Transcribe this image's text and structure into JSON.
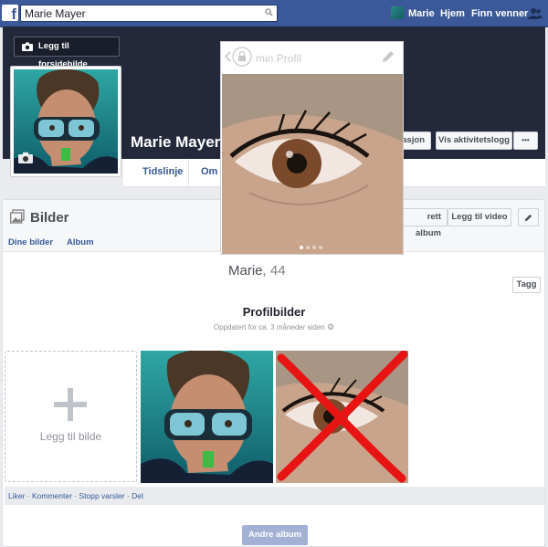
{
  "search": {
    "value": "Marie Mayer"
  },
  "topnav": {
    "user_label": "Marie",
    "home_label": "Hjem",
    "find_friends_label": "Finn venner"
  },
  "cover": {
    "add_cover_label": "Legg til forsidebilde"
  },
  "profile": {
    "name": "Marie Mayer"
  },
  "tabs": {
    "timeline": "Tidslinje",
    "about": "Om",
    "info_fragment": "asjon",
    "activity_log": "Vis aktivitetslogg",
    "more": "•••"
  },
  "photos": {
    "title": "Bilder",
    "your_photos": "Dine bilder",
    "albums": "Album",
    "create_album_fragment": "rett album",
    "add_video": "Legg til video",
    "tag_button": "Tagg",
    "album_title": "Profilbilder",
    "album_updated": "Oppdatert for ca. 3 måneder siden",
    "add_photo_label": "Legg til bilde",
    "actions": "Liker · Kommenter · Stopp varsler · Del",
    "other_albums": "Andre album"
  },
  "overlay": {
    "title": "min Profil",
    "name": "Marie",
    "age": ", 44"
  },
  "colors": {
    "brand_blue": "#3b5998",
    "cross_red": "#e81414"
  }
}
